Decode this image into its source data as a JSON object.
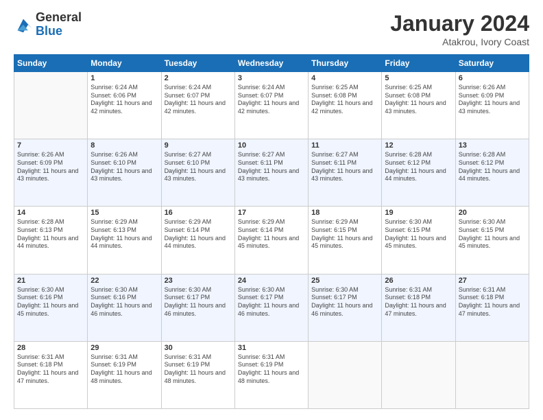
{
  "header": {
    "logo_general": "General",
    "logo_blue": "Blue",
    "month_year": "January 2024",
    "location": "Atakrou, Ivory Coast"
  },
  "days_of_week": [
    "Sunday",
    "Monday",
    "Tuesday",
    "Wednesday",
    "Thursday",
    "Friday",
    "Saturday"
  ],
  "weeks": [
    [
      {
        "day": "",
        "sunrise": "",
        "sunset": "",
        "daylight": ""
      },
      {
        "day": "1",
        "sunrise": "Sunrise: 6:24 AM",
        "sunset": "Sunset: 6:06 PM",
        "daylight": "Daylight: 11 hours and 42 minutes."
      },
      {
        "day": "2",
        "sunrise": "Sunrise: 6:24 AM",
        "sunset": "Sunset: 6:07 PM",
        "daylight": "Daylight: 11 hours and 42 minutes."
      },
      {
        "day": "3",
        "sunrise": "Sunrise: 6:24 AM",
        "sunset": "Sunset: 6:07 PM",
        "daylight": "Daylight: 11 hours and 42 minutes."
      },
      {
        "day": "4",
        "sunrise": "Sunrise: 6:25 AM",
        "sunset": "Sunset: 6:08 PM",
        "daylight": "Daylight: 11 hours and 42 minutes."
      },
      {
        "day": "5",
        "sunrise": "Sunrise: 6:25 AM",
        "sunset": "Sunset: 6:08 PM",
        "daylight": "Daylight: 11 hours and 43 minutes."
      },
      {
        "day": "6",
        "sunrise": "Sunrise: 6:26 AM",
        "sunset": "Sunset: 6:09 PM",
        "daylight": "Daylight: 11 hours and 43 minutes."
      }
    ],
    [
      {
        "day": "7",
        "sunrise": "Sunrise: 6:26 AM",
        "sunset": "Sunset: 6:09 PM",
        "daylight": "Daylight: 11 hours and 43 minutes."
      },
      {
        "day": "8",
        "sunrise": "Sunrise: 6:26 AM",
        "sunset": "Sunset: 6:10 PM",
        "daylight": "Daylight: 11 hours and 43 minutes."
      },
      {
        "day": "9",
        "sunrise": "Sunrise: 6:27 AM",
        "sunset": "Sunset: 6:10 PM",
        "daylight": "Daylight: 11 hours and 43 minutes."
      },
      {
        "day": "10",
        "sunrise": "Sunrise: 6:27 AM",
        "sunset": "Sunset: 6:11 PM",
        "daylight": "Daylight: 11 hours and 43 minutes."
      },
      {
        "day": "11",
        "sunrise": "Sunrise: 6:27 AM",
        "sunset": "Sunset: 6:11 PM",
        "daylight": "Daylight: 11 hours and 43 minutes."
      },
      {
        "day": "12",
        "sunrise": "Sunrise: 6:28 AM",
        "sunset": "Sunset: 6:12 PM",
        "daylight": "Daylight: 11 hours and 44 minutes."
      },
      {
        "day": "13",
        "sunrise": "Sunrise: 6:28 AM",
        "sunset": "Sunset: 6:12 PM",
        "daylight": "Daylight: 11 hours and 44 minutes."
      }
    ],
    [
      {
        "day": "14",
        "sunrise": "Sunrise: 6:28 AM",
        "sunset": "Sunset: 6:13 PM",
        "daylight": "Daylight: 11 hours and 44 minutes."
      },
      {
        "day": "15",
        "sunrise": "Sunrise: 6:29 AM",
        "sunset": "Sunset: 6:13 PM",
        "daylight": "Daylight: 11 hours and 44 minutes."
      },
      {
        "day": "16",
        "sunrise": "Sunrise: 6:29 AM",
        "sunset": "Sunset: 6:14 PM",
        "daylight": "Daylight: 11 hours and 44 minutes."
      },
      {
        "day": "17",
        "sunrise": "Sunrise: 6:29 AM",
        "sunset": "Sunset: 6:14 PM",
        "daylight": "Daylight: 11 hours and 45 minutes."
      },
      {
        "day": "18",
        "sunrise": "Sunrise: 6:29 AM",
        "sunset": "Sunset: 6:15 PM",
        "daylight": "Daylight: 11 hours and 45 minutes."
      },
      {
        "day": "19",
        "sunrise": "Sunrise: 6:30 AM",
        "sunset": "Sunset: 6:15 PM",
        "daylight": "Daylight: 11 hours and 45 minutes."
      },
      {
        "day": "20",
        "sunrise": "Sunrise: 6:30 AM",
        "sunset": "Sunset: 6:15 PM",
        "daylight": "Daylight: 11 hours and 45 minutes."
      }
    ],
    [
      {
        "day": "21",
        "sunrise": "Sunrise: 6:30 AM",
        "sunset": "Sunset: 6:16 PM",
        "daylight": "Daylight: 11 hours and 45 minutes."
      },
      {
        "day": "22",
        "sunrise": "Sunrise: 6:30 AM",
        "sunset": "Sunset: 6:16 PM",
        "daylight": "Daylight: 11 hours and 46 minutes."
      },
      {
        "day": "23",
        "sunrise": "Sunrise: 6:30 AM",
        "sunset": "Sunset: 6:17 PM",
        "daylight": "Daylight: 11 hours and 46 minutes."
      },
      {
        "day": "24",
        "sunrise": "Sunrise: 6:30 AM",
        "sunset": "Sunset: 6:17 PM",
        "daylight": "Daylight: 11 hours and 46 minutes."
      },
      {
        "day": "25",
        "sunrise": "Sunrise: 6:30 AM",
        "sunset": "Sunset: 6:17 PM",
        "daylight": "Daylight: 11 hours and 46 minutes."
      },
      {
        "day": "26",
        "sunrise": "Sunrise: 6:31 AM",
        "sunset": "Sunset: 6:18 PM",
        "daylight": "Daylight: 11 hours and 47 minutes."
      },
      {
        "day": "27",
        "sunrise": "Sunrise: 6:31 AM",
        "sunset": "Sunset: 6:18 PM",
        "daylight": "Daylight: 11 hours and 47 minutes."
      }
    ],
    [
      {
        "day": "28",
        "sunrise": "Sunrise: 6:31 AM",
        "sunset": "Sunset: 6:18 PM",
        "daylight": "Daylight: 11 hours and 47 minutes."
      },
      {
        "day": "29",
        "sunrise": "Sunrise: 6:31 AM",
        "sunset": "Sunset: 6:19 PM",
        "daylight": "Daylight: 11 hours and 48 minutes."
      },
      {
        "day": "30",
        "sunrise": "Sunrise: 6:31 AM",
        "sunset": "Sunset: 6:19 PM",
        "daylight": "Daylight: 11 hours and 48 minutes."
      },
      {
        "day": "31",
        "sunrise": "Sunrise: 6:31 AM",
        "sunset": "Sunset: 6:19 PM",
        "daylight": "Daylight: 11 hours and 48 minutes."
      },
      {
        "day": "",
        "sunrise": "",
        "sunset": "",
        "daylight": ""
      },
      {
        "day": "",
        "sunrise": "",
        "sunset": "",
        "daylight": ""
      },
      {
        "day": "",
        "sunrise": "",
        "sunset": "",
        "daylight": ""
      }
    ]
  ]
}
